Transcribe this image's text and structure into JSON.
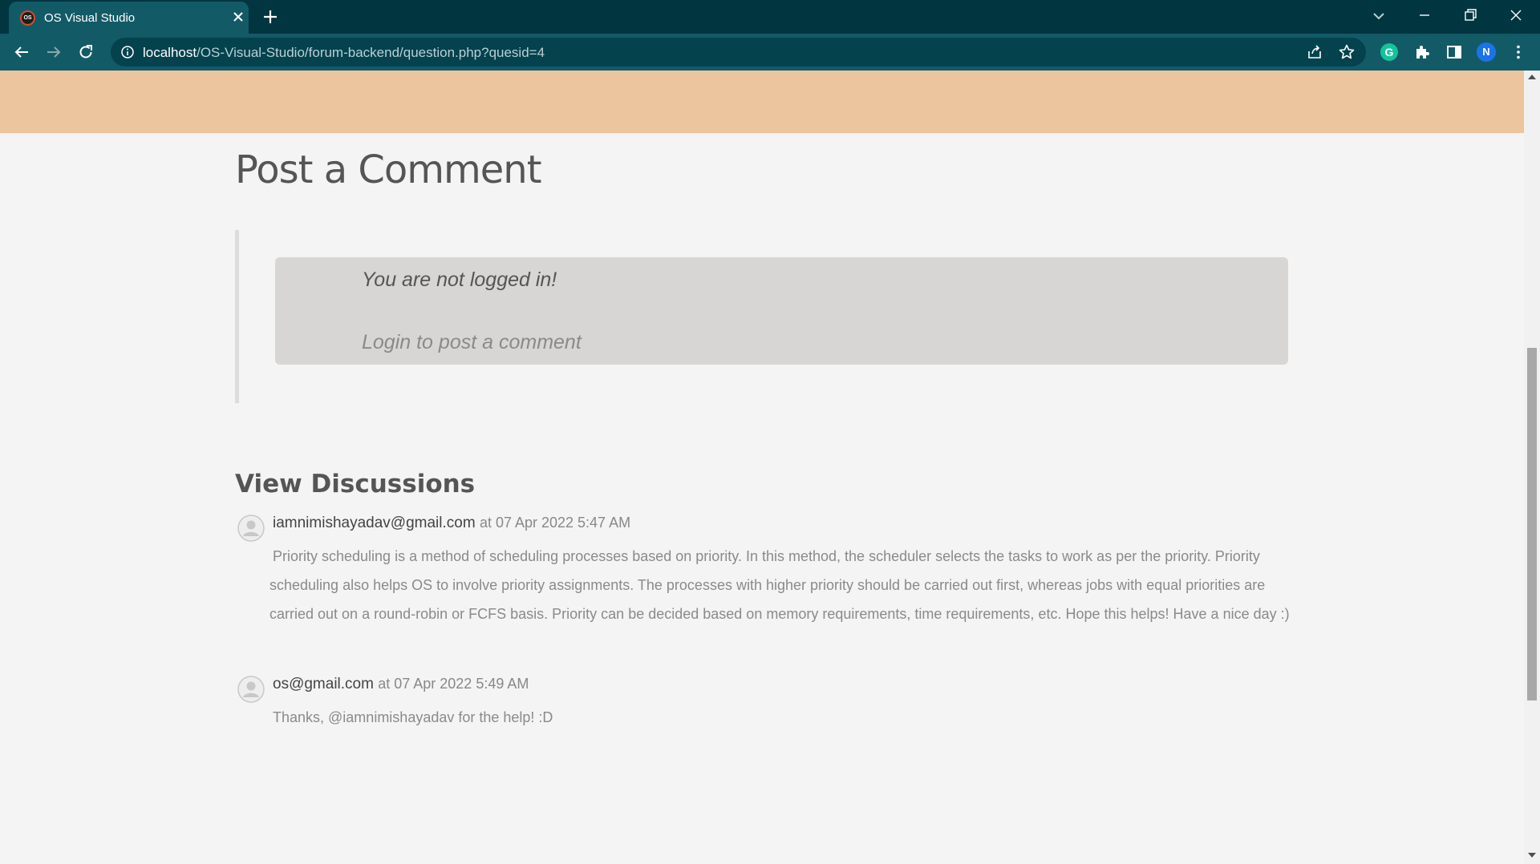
{
  "browser": {
    "tab_title": "OS Visual Studio",
    "favicon_text": "OS",
    "url_host": "localhost",
    "url_path": "/OS-Visual-Studio/forum-backend/question.php?quesid=4",
    "extension_letter": "G",
    "profile_initial": "N"
  },
  "page": {
    "title": "Post a Comment",
    "not_logged_in": "You are not logged in!",
    "login_link": "Login to post a comment",
    "discussions_title": "View Discussions"
  },
  "comments": [
    {
      "user": "iamnimishayadav@gmail.com",
      "time": "at 07 Apr 2022 5:47 AM",
      "body": "Priority scheduling is a method of scheduling processes based on priority. In this method, the scheduler selects the tasks to work as per the priority. Priority scheduling also helps OS to involve priority assignments. The processes with higher priority should be carried out first, whereas jobs with equal priorities are carried out on a round-robin or FCFS basis. Priority can be decided based on memory requirements, time requirements, etc. Hope this helps! Have a nice day :)"
    },
    {
      "user": "os@gmail.com",
      "time": "at 07 Apr 2022 5:49 AM",
      "body": "Thanks, @iamnimishayadav for the help! :D"
    }
  ],
  "colors": {
    "tabbar": "#013540",
    "toolbar": "#135a67",
    "hero_band": "#ecc59e",
    "login_box": "#d8d5d5"
  }
}
